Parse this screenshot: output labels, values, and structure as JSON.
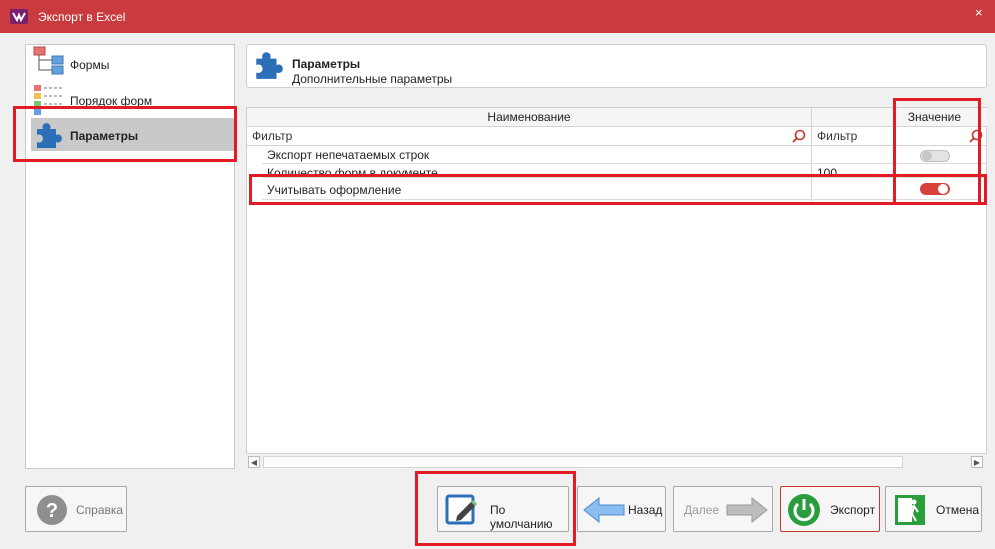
{
  "window": {
    "title": "Экспорт в Excel",
    "close_glyph": "×"
  },
  "nav": {
    "items": [
      {
        "label": "Формы",
        "icon": "forms-tree-icon"
      },
      {
        "label": "Порядок форм",
        "icon": "form-order-icon"
      },
      {
        "label": "Параметры",
        "icon": "puzzle-icon",
        "selected": true
      }
    ]
  },
  "header": {
    "title": "Параметры",
    "subtitle": "Дополнительные параметры",
    "icon": "puzzle-icon"
  },
  "grid": {
    "columns": [
      "Наименование",
      "Значение"
    ],
    "filter_placeholder": "Фильтр",
    "value_filter_placeholder": "Фильтр",
    "rows": [
      {
        "name": "Экспорт непечатаемых строк",
        "value": "",
        "toggle": false
      },
      {
        "name": "Количество форм в документе",
        "value": "100"
      },
      {
        "name": "Учитывать оформление",
        "value": "",
        "toggle": true
      }
    ]
  },
  "buttons": {
    "help": "Справка",
    "defaults": "По умолчанию",
    "back": "Назад",
    "next": "Далее",
    "export": "Экспорт",
    "cancel": "Отмена"
  },
  "colors": {
    "titlebar": "#c93b3e",
    "toggle_on": "#d6423b",
    "highlight": "#e31b24",
    "export_green": "#2a9d3d",
    "arrow_blue": "#6aa6e0"
  }
}
